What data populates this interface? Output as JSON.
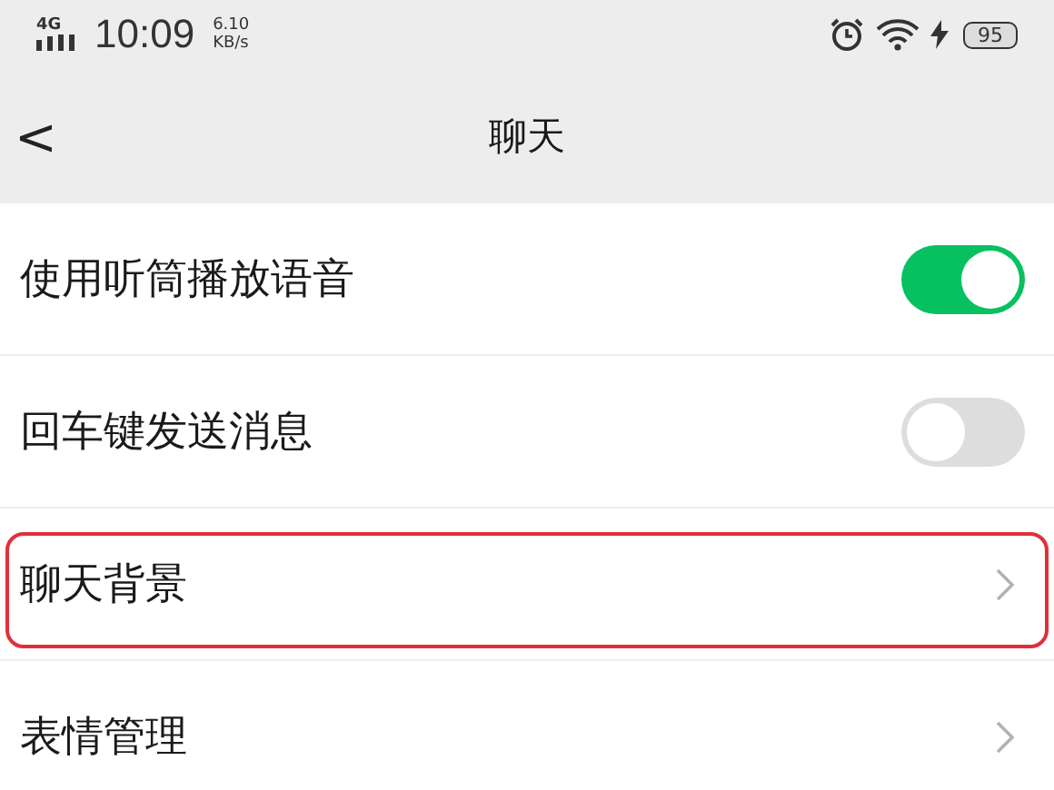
{
  "status_bar": {
    "network": "4G",
    "time": "10:09",
    "speed": "6.10",
    "speed_unit": "KB/s",
    "battery": "95"
  },
  "nav": {
    "back": "<",
    "title": "聊天"
  },
  "items": [
    {
      "kind": "toggle",
      "label": "使用听筒播放语音",
      "on": true,
      "highlighted": false
    },
    {
      "kind": "toggle",
      "label": "回车键发送消息",
      "on": false,
      "highlighted": false
    },
    {
      "kind": "link",
      "label": "聊天背景",
      "highlighted": true
    },
    {
      "kind": "link",
      "label": "表情管理",
      "highlighted": false
    }
  ]
}
